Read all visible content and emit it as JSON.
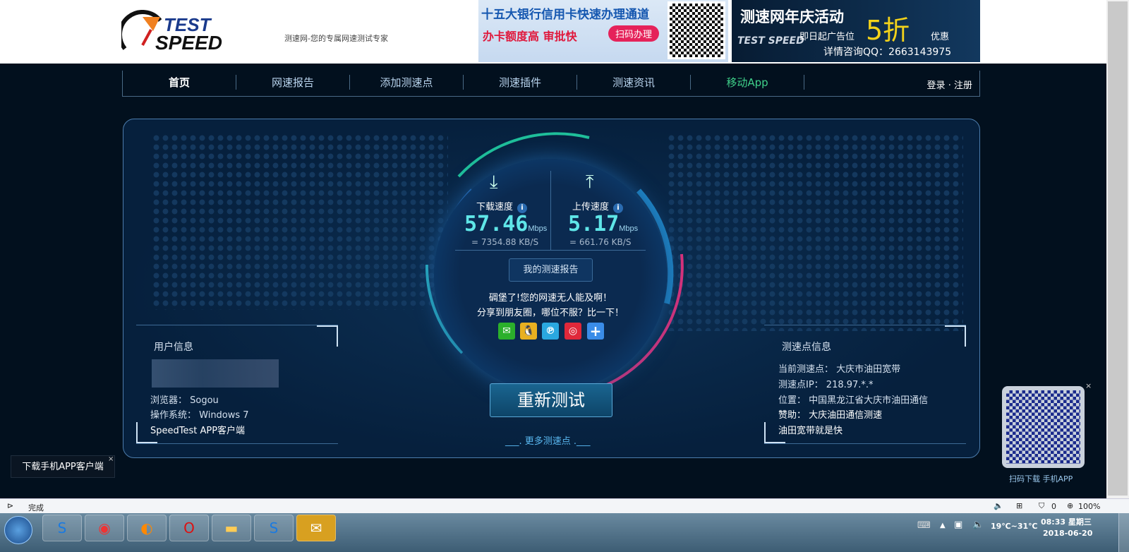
{
  "header": {
    "logo_text": "TEST SPEED",
    "slogan": "测速网-您的专属网速测试专家",
    "ad1": {
      "title": "十五大银行信用卡快速办理通道",
      "subtitle": "办卡额度高 审批快",
      "button": "扫码办理"
    },
    "ad2": {
      "title": "测速网年庆活动",
      "line1": "即日起广告位",
      "discount": "5折",
      "suffix": "优惠",
      "contact": "详情咨询QQ：2663143975",
      "logo": "TEST SPEED"
    }
  },
  "nav": {
    "items": [
      "首页",
      "网速报告",
      "添加测速点",
      "测速插件",
      "测速资讯",
      "移动App"
    ],
    "login": "登录",
    "dot": "·",
    "register": "注册"
  },
  "result": {
    "download_label": "下载速度",
    "download_mbps": "57.46",
    "download_kbs": "= 7354.88  KB/S",
    "upload_label": "上传速度",
    "upload_mbps": "5.17",
    "upload_kbs": "= 661.76  KB/S",
    "unit": "Mbps",
    "report_button": "我的测速报告",
    "msg1": "碉堡了!您的网速无人能及啊！",
    "msg2": "分享到朋友圈，哪位不服？比一下！",
    "retest": "重新测试",
    "more": "___. 更多测速点 .___"
  },
  "user_info": {
    "title": "用户信息",
    "browser": "浏览器： Sogou",
    "os": "操作系统： Windows 7",
    "app": "SpeedTest APP客户端"
  },
  "node_info": {
    "title": "测速点信息",
    "current": "当前测速点： 大庆市油田宽带",
    "ip": "测速点IP： 218.97.*.*",
    "location": "位置： 中国黑龙江省大庆市油田通信",
    "sponsor": "赞助： 大庆油田通信测速",
    "slogan": "油田宽带就是快"
  },
  "side": {
    "qr_label": "扫码下载 手机APP",
    "close": "×",
    "app_download": "下载手机APP客户端"
  },
  "statusbar": {
    "status": "完成",
    "ad_count": "0",
    "zoom": "100%"
  },
  "taskbar": {
    "weather": "19℃~31℃",
    "time": "08:33 星期三",
    "date": "2018-06-20"
  }
}
